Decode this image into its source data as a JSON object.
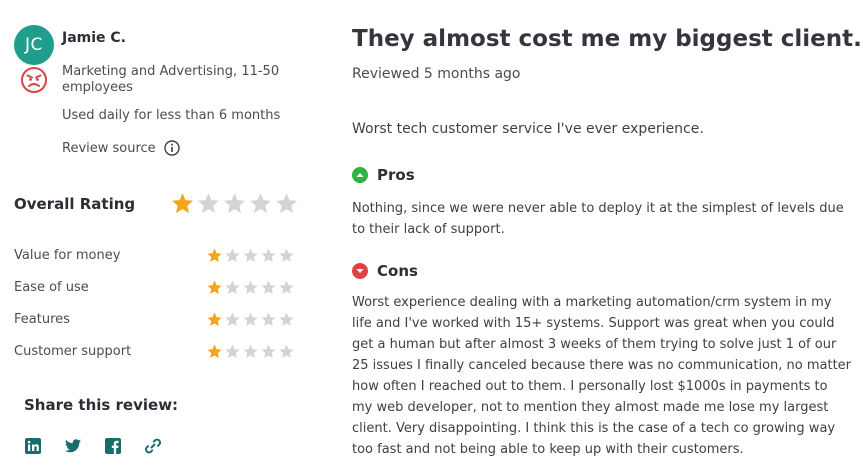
{
  "reviewer": {
    "initials": "JC",
    "avatar_color": "#1f9e8d",
    "name": "Jamie C.",
    "sentiment_icon": "angry-face-icon",
    "industry": "Marketing and Advertising, 11-50 employees",
    "usage": "Used daily for less than 6 months",
    "review_source_label": "Review source"
  },
  "ratings": {
    "overall_label": "Overall Rating",
    "overall_value": 1,
    "max": 5,
    "star_color": "#f3a41b",
    "empty_star_color": "#d4d4d8",
    "items": [
      {
        "label": "Value for money",
        "value": 1
      },
      {
        "label": "Ease of use",
        "value": 1
      },
      {
        "label": "Features",
        "value": 1
      },
      {
        "label": "Customer support",
        "value": 1
      }
    ]
  },
  "share": {
    "title": "Share this review:",
    "icons": [
      "linkedin-icon",
      "twitter-icon",
      "facebook-icon",
      "link-icon"
    ]
  },
  "review": {
    "title": "They almost cost me my biggest client.",
    "reviewed": "Reviewed 5 months ago",
    "summary": "Worst tech customer service I've ever experience.",
    "pros_label": "Pros",
    "pros_color": "#2fb344",
    "pros_text": "Nothing, since we were never able to deploy it at the simplest of levels due to their lack of support.",
    "cons_label": "Cons",
    "cons_color": "#d94545",
    "cons_text": "Worst experience dealing with a marketing automation/crm system in my life and I've worked with 15+ systems. Support was great when you could get a human but after almost 3 weeks of them trying to solve just 1 of our 25 issues I finally canceled because there was no communication, no matter how often I reached out to them. I personally lost $1000s in payments to my web developer, not to mention they almost made me lose my largest client. Very disappointing. I think this is the case of a tech co growing way too fast and not being able to keep up with their customers."
  }
}
